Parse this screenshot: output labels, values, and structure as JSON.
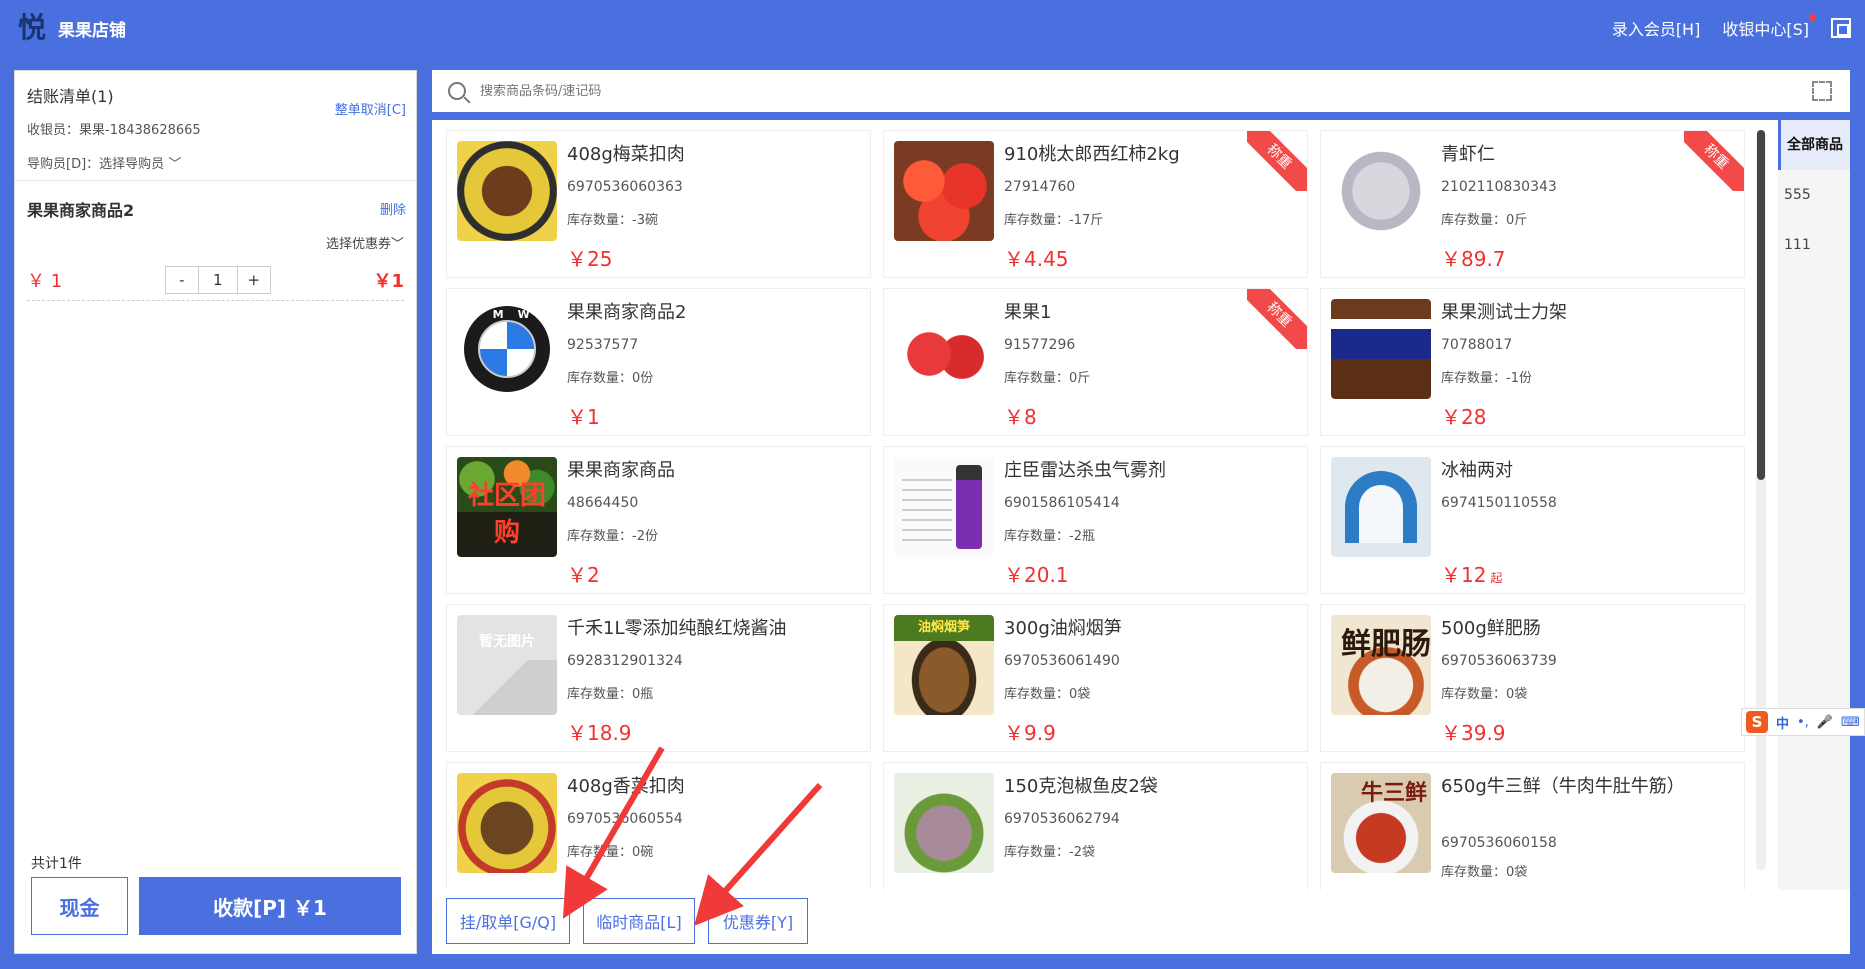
{
  "app": {
    "store_name": "果果店铺",
    "logo_char": "悦"
  },
  "header": {
    "member_entry": "录入会员[H]",
    "cashier_center": "收银中心[S]"
  },
  "order": {
    "title": "结账清单(1)",
    "cancel_all": "整单取消[C]",
    "cashier_label": "收银员：果果-18438628665",
    "guide_label": "导购员[D]：",
    "guide_select": "选择导购员",
    "item": {
      "name": "果果商家商品2",
      "delete": "删除",
      "coupon_select": "选择优惠券",
      "unit_price": "￥ 1",
      "qty_minus": "-",
      "qty": "1",
      "qty_plus": "+",
      "subtotal": "￥1"
    },
    "total_count": "共计1件",
    "cash_btn": "现金",
    "pay_btn": "收款[P] ￥1"
  },
  "search": {
    "placeholder": "搜索商品条码/速记码"
  },
  "categories": [
    {
      "label": "全部商品",
      "active": true
    },
    {
      "label": "555",
      "active": false
    },
    {
      "label": "111",
      "active": false
    }
  ],
  "products": [
    {
      "name": "408g梅菜扣肉",
      "code": "6970536060363",
      "stock": "库存数量：-3碗",
      "price": "￥25",
      "thumb": "t-food1",
      "ribbon": ""
    },
    {
      "name": "910桃太郎西红柿2kg",
      "code": "27914760",
      "stock": "库存数量：-17斤",
      "price": "￥4.45",
      "thumb": "t-tomato",
      "ribbon": "称重"
    },
    {
      "name": "青虾仁",
      "code": "2102110830343",
      "stock": "库存数量：0斤",
      "price": "￥89.7",
      "thumb": "t-shrimp",
      "ribbon": "称重"
    },
    {
      "name": "果果商家商品2",
      "code": "92537577",
      "stock": "库存数量：0份",
      "price": "￥1",
      "thumb": "t-bmw",
      "ribbon": ""
    },
    {
      "name": "果果1",
      "code": "91577296",
      "stock": "库存数量：0斤",
      "price": "￥8",
      "thumb": "t-apple",
      "ribbon": "称重"
    },
    {
      "name": "果果测试士力架",
      "code": "70788017",
      "stock": "库存数量：-1份",
      "price": "￥28",
      "thumb": "t-snickers",
      "ribbon": ""
    },
    {
      "name": "果果商家商品",
      "code": "48664450",
      "stock": "库存数量：-2份",
      "price": "￥2",
      "thumb": "t-veg",
      "ribbon": ""
    },
    {
      "name": "庄臣雷达杀虫气雾剂",
      "code": "6901586105414",
      "stock": "库存数量：-2瓶",
      "price": "￥20.1",
      "thumb": "t-spray",
      "ribbon": ""
    },
    {
      "name": "冰袖两对",
      "code": "6974150110558",
      "stock": "",
      "price": "￥12",
      "price_suffix": "起",
      "thumb": "t-ice",
      "ribbon": ""
    },
    {
      "name": "千禾1L零添加纯酿红烧酱油",
      "code": "6928312901324",
      "stock": "库存数量：0瓶",
      "price": "￥18.9",
      "thumb": "t-none",
      "ribbon": ""
    },
    {
      "name": "300g油焖烟笋",
      "code": "6970536061490",
      "stock": "库存数量：0袋",
      "price": "￥9.9",
      "thumb": "t-bamboo",
      "ribbon": ""
    },
    {
      "name": "500g鲜肥肠",
      "code": "6970536063739",
      "stock": "库存数量：0袋",
      "price": "￥39.9",
      "thumb": "t-sausage",
      "ribbon": ""
    },
    {
      "name": "408g香菜扣肉",
      "code": "6970536060554",
      "stock": "库存数量：0碗",
      "price": "",
      "thumb": "t-food2",
      "ribbon": ""
    },
    {
      "name": "150克泡椒鱼皮2袋",
      "code": "6970536062794",
      "stock": "库存数量：-2袋",
      "price": "",
      "thumb": "t-fish",
      "ribbon": ""
    },
    {
      "name": "650g牛三鲜（牛肉牛肚牛筋）",
      "code": "6970536060158",
      "stock": "库存数量：0袋",
      "price": "",
      "thumb": "t-tripe",
      "ribbon": ""
    }
  ],
  "thumb_text": {
    "veg": "社区团购",
    "none": "暂无图片",
    "bamboo": "油焖烟笋",
    "sausage": "鲜肥肠",
    "tripe": "牛三鲜",
    "bmw": "BMW"
  },
  "bottom": {
    "hold_order": "挂/取单[G/Q]",
    "temp_item": "临时商品[L]",
    "coupon": "优惠券[Y]"
  },
  "ime": {
    "s": "S",
    "zh": "中",
    "punct": "•,",
    "mic": "🎤",
    "kbd": "⌨"
  },
  "colors": {
    "brand": "#4a70e0",
    "price_red": "#f23030",
    "ribbon": "#f24949",
    "arrow": "#f03a3a"
  }
}
